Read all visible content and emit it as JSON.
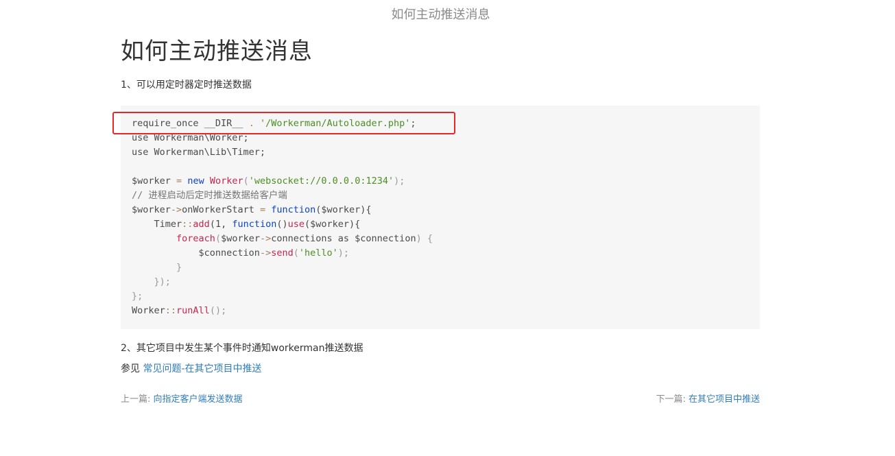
{
  "header": {
    "title": "如何主动推送消息"
  },
  "article": {
    "heading": "如何主动推送消息",
    "p1": "1、可以用定时器定时推送数据",
    "code": {
      "line1": {
        "a": "require_once __DIR__ ",
        "b": ".",
        "c": " ",
        "d": "'/Workerman/Autoloader.php'",
        "e": ";"
      },
      "line2": "use Workerman\\Worker;",
      "line3": "use Workerman\\Lib\\Timer;",
      "line5": {
        "a": "$worker ",
        "b": "=",
        "c": " ",
        "d": "new",
        "e": " ",
        "f": "Worker",
        "g": "(",
        "h": "'websocket://0.0.0.0:1234'",
        "i": ");"
      },
      "line6": "// 进程启动后定时推送数据给客户端",
      "line7": {
        "a": "$worker",
        "b": "->",
        "c": "onWorkerStart ",
        "d": "=",
        "e": " ",
        "f": "function",
        "g": "($worker){"
      },
      "line8": {
        "a": "    Timer",
        "b": "::",
        "c": "add",
        "d": "(1, ",
        "e": "function",
        "f": "()",
        "g": "use",
        "h": "($worker){"
      },
      "line9": {
        "a": "        ",
        "b": "foreach",
        "c": "(",
        "d": "$worker",
        "e": "->",
        "f": "connections as $connection",
        "g": ") {"
      },
      "line10": {
        "a": "            $connection",
        "b": "->",
        "c": "send",
        "d": "(",
        "e": "'hello'",
        "f": ");"
      },
      "line11": "        }",
      "line12": "    });",
      "line13": "};",
      "line14": {
        "a": "Worker",
        "b": "::",
        "c": "runAll",
        "d": "();"
      }
    },
    "p2": "2、其它项目中发生某个事件时通知workerman推送数据",
    "p3_prefix": "参见 ",
    "p3_link": "常见问题-在其它项目中推送"
  },
  "nav": {
    "prev_label": "上一篇: ",
    "prev_link": "向指定客户端发送数据",
    "next_label": "下一篇: ",
    "next_link": "在其它项目中推送"
  },
  "colors": {
    "highlight_border": "#e8262a",
    "link": "#2f7dbd",
    "code_bg": "#f6f6f6"
  }
}
